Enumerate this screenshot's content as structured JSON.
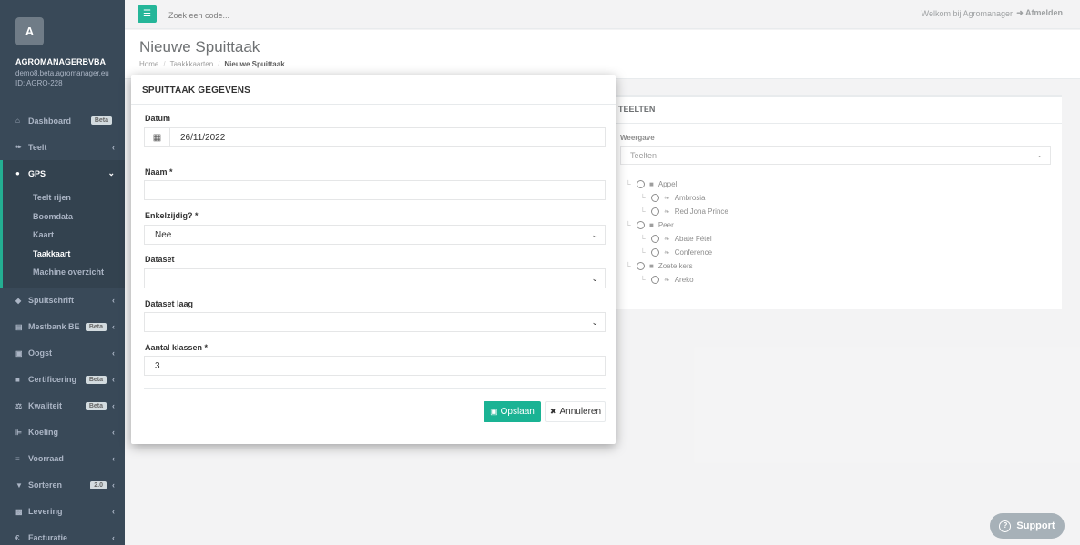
{
  "sidebar": {
    "logo_letter": "A",
    "company_name": "AGROMANAGERBVBA",
    "company_domain": "demo8.beta.agromanager.eu",
    "company_id": "ID: AGRO-228",
    "items": [
      {
        "label": "Dashboard",
        "badge": "Beta"
      },
      {
        "label": "Teelt"
      },
      {
        "label": "GPS"
      },
      {
        "label": "Spuitschrift"
      },
      {
        "label": "Mestbank BE",
        "badge": "Beta"
      },
      {
        "label": "Oogst"
      },
      {
        "label": "Certificering",
        "badge": "Beta"
      },
      {
        "label": "Kwaliteit",
        "badge": "Beta"
      },
      {
        "label": "Koeling"
      },
      {
        "label": "Voorraad"
      },
      {
        "label": "Sorteren",
        "badge": "2.0"
      },
      {
        "label": "Levering"
      },
      {
        "label": "Facturatie"
      }
    ],
    "gps_sub": [
      "Teelt rijen",
      "Boomdata",
      "Kaart",
      "Taakkaart",
      "Machine overzicht"
    ]
  },
  "topbar": {
    "search_placeholder": "Zoek een code...",
    "welcome": "Welkom bij Agromanager",
    "logout": "Afmelden"
  },
  "heading": {
    "title": "Nieuwe Spuittaak",
    "breadcrumb": [
      "Home",
      "Taakkkaarten",
      "Nieuwe Spuittaak"
    ]
  },
  "teelten": {
    "title": "TEELTEN",
    "weergave_label": "Weergave",
    "weergave_value": "Teelten",
    "tree": [
      {
        "label": "Appel",
        "level": 0
      },
      {
        "label": "Ambrosia",
        "level": 1
      },
      {
        "label": "Red Jona Prince",
        "level": 1
      },
      {
        "label": "Peer",
        "level": 0
      },
      {
        "label": "Abate Fétel",
        "level": 1
      },
      {
        "label": "Conference",
        "level": 1
      },
      {
        "label": "Zoete kers",
        "level": 0
      },
      {
        "label": "Areko",
        "level": 1
      }
    ]
  },
  "modal": {
    "title": "SPUITTAAK GEGEVENS",
    "datum_label": "Datum",
    "datum_value": "26/11/2022",
    "naam_label": "Naam *",
    "naam_value": "",
    "enkelzijdig_label": "Enkelzijdig? *",
    "enkelzijdig_value": "Nee",
    "dataset_label": "Dataset",
    "dataset_value": "",
    "dataset_laag_label": "Dataset laag",
    "dataset_laag_value": "",
    "klassen_label": "Aantal klassen *",
    "klassen_value": "3",
    "save_label": "Opslaan",
    "cancel_label": "Annuleren"
  },
  "support_label": "Support",
  "colors": {
    "sidebar_bg": "#2f4050",
    "accent": "#1ab394"
  }
}
